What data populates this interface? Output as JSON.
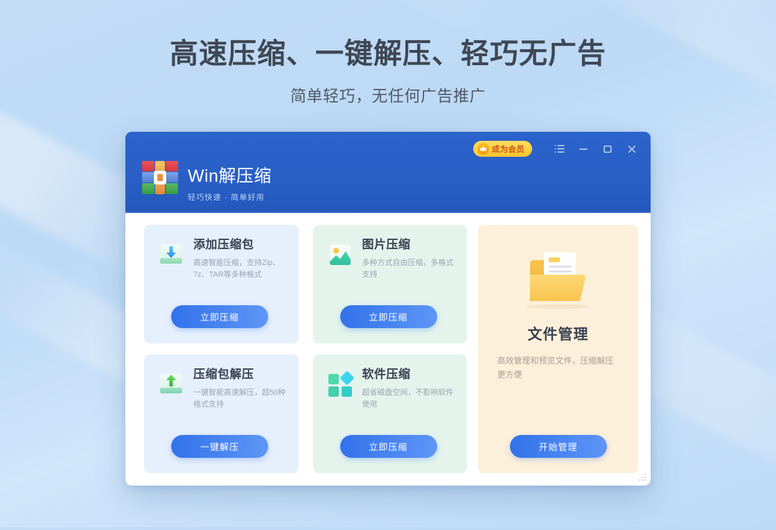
{
  "hero": {
    "title": "高速压缩、一键解压、轻巧无广告",
    "subtitle": "简单轻巧，无任何广告推广"
  },
  "window": {
    "brand_name": "Win解压缩",
    "brand_slogan": "轻巧快速 · 简单好用",
    "member_badge": "成为会员",
    "controls": {
      "menu": "menu-icon",
      "minimize": "minimize-icon",
      "maximize": "maximize-icon",
      "close": "close-icon"
    }
  },
  "cards": [
    {
      "id": "add-archive",
      "title": "添加压缩包",
      "desc": "高速智能压缩，支持Zip、7z、TAR等多种格式",
      "button": "立即压缩",
      "icon": "archive-download-icon",
      "theme": "blue"
    },
    {
      "id": "image-compress",
      "title": "图片压缩",
      "desc": "多种方式自由压缩，多格式支持",
      "button": "立即压缩",
      "icon": "picture-icon",
      "theme": "green"
    },
    {
      "id": "extract-archive",
      "title": "压缩包解压",
      "desc": "一键智能高速解压，超50种格式支持",
      "button": "一键解压",
      "icon": "archive-upload-icon",
      "theme": "blue"
    },
    {
      "id": "software-compress",
      "title": "软件压缩",
      "desc": "超省磁盘空间，不影响软件使用",
      "button": "立即压缩",
      "icon": "four-squares-icon",
      "theme": "green"
    }
  ],
  "side_panel": {
    "title": "文件管理",
    "desc": "高效管理和预览文件，压缩解压更方便",
    "button": "开始管理",
    "icon": "folder-document-icon"
  },
  "colors": {
    "page_bg": "#c3dcf6",
    "titlebar": "#2a5fc6",
    "card_blue": "#e6effc",
    "card_green": "#e4f4ec",
    "panel_cream": "#fdf0db",
    "button_blue": "#3272ea",
    "badge_gold": "#fcc62f",
    "title_text": "#3a4151",
    "desc_text": "#9aa3b2"
  }
}
